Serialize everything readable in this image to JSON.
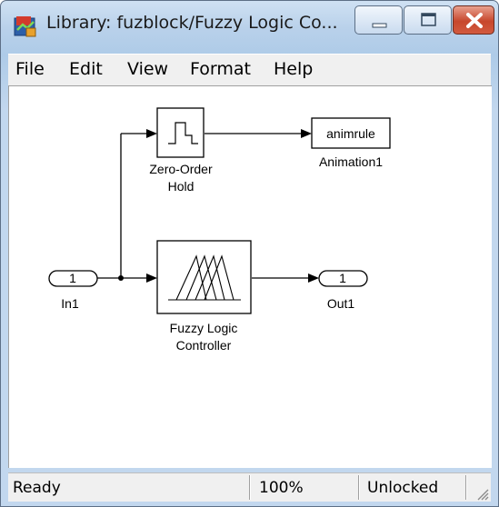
{
  "window": {
    "title": "Library: fuzblock/Fuzzy Logic  Co..."
  },
  "menu": {
    "items": [
      "File",
      "Edit",
      "View",
      "Format",
      "Help"
    ]
  },
  "diagram": {
    "blocks": {
      "zero_order_hold": {
        "label_line1": "Zero-Order",
        "label_line2": "Hold"
      },
      "animation": {
        "text": "animrule",
        "label": "Animation1"
      },
      "inport": {
        "number": "1",
        "label": "In1"
      },
      "fuzzy_controller": {
        "label_line1": "Fuzzy Logic",
        "label_line2": "Controller"
      },
      "outport": {
        "number": "1",
        "label": "Out1"
      }
    }
  },
  "status": {
    "state": "Ready",
    "zoom": "100%",
    "lock": "Unlocked"
  },
  "colors": {
    "title_bar": "#b9d1ea",
    "close_button": "#c7472c",
    "canvas": "#ffffff",
    "signal_line": "#000000"
  }
}
